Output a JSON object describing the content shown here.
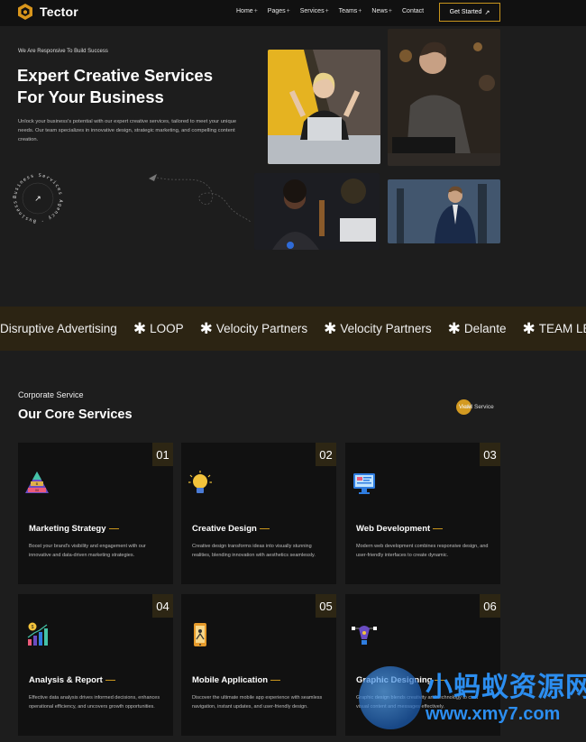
{
  "nav": {
    "brand": "Tector",
    "items": [
      {
        "label": "Home",
        "suffix": "+"
      },
      {
        "label": "Pages",
        "suffix": "+"
      },
      {
        "label": "Services",
        "suffix": "+"
      },
      {
        "label": "Teams",
        "suffix": "+"
      },
      {
        "label": "News",
        "suffix": "+"
      },
      {
        "label": "Contact",
        "suffix": ""
      }
    ],
    "cta": "Get Started",
    "cta_arrow": "↗"
  },
  "hero": {
    "eyebrow": "We Are Responsive To Build Success",
    "title_line1": "Expert Creative Services",
    "title_line2": "For Your Business",
    "description": "Unlock your business's potential with our expert creative services, tailored to meet your unique needs. Our team specializes in innovative design, strategic marketing, and compelling content creation.",
    "badge_text": "Business Services Agency · Business Tools ·",
    "badge_arrow": "↗"
  },
  "ticker": [
    "Disruptive Advertising",
    "LOOP",
    "Velocity Partners",
    "Velocity Partners",
    "Delante",
    "TEAM LEWIS"
  ],
  "services": {
    "eyebrow": "Corporate Service",
    "title": "Our Core Services",
    "view_all_prefix": "View",
    "view_all_suffix": " All Service",
    "cards": [
      {
        "num": "01",
        "title": "Marketing Strategy",
        "icon": "pyramid-chart-icon",
        "desc": "Boost your brand's visibility and engagement with our innovative and data-driven marketing strategies."
      },
      {
        "num": "02",
        "title": "Creative Design",
        "icon": "lightbulb-icon",
        "desc": "Creative design transforms ideas into visually stunning realities, blending innovation with aesthetics seamlessly."
      },
      {
        "num": "03",
        "title": "Web Development",
        "icon": "monitor-code-icon",
        "desc": "Modern web development combines responsive design, and user-friendly interfaces to create dynamic."
      },
      {
        "num": "04",
        "title": "Analysis & Report",
        "icon": "growth-chart-icon",
        "desc": "Effective data analysis drives informed decisions, enhances operational efficiency, and uncovers growth opportunities."
      },
      {
        "num": "05",
        "title": "Mobile Application",
        "icon": "mobile-app-icon",
        "desc": "Discover the ultimate mobile app experience with seamless navigation, instant updates, and user-friendly design."
      },
      {
        "num": "06",
        "title": "Graphic Designing",
        "icon": "pen-tool-icon",
        "desc": "Graphic design blends creativity and technology to craft visual content and messages effectively."
      }
    ]
  },
  "watermark": {
    "cn": "小蚂蚁资源网",
    "url": "www.xmy7.com"
  },
  "colors": {
    "accent": "#c8951d",
    "background": "#1d1d1d",
    "card": "#111111",
    "ticker": "#2c2413"
  }
}
